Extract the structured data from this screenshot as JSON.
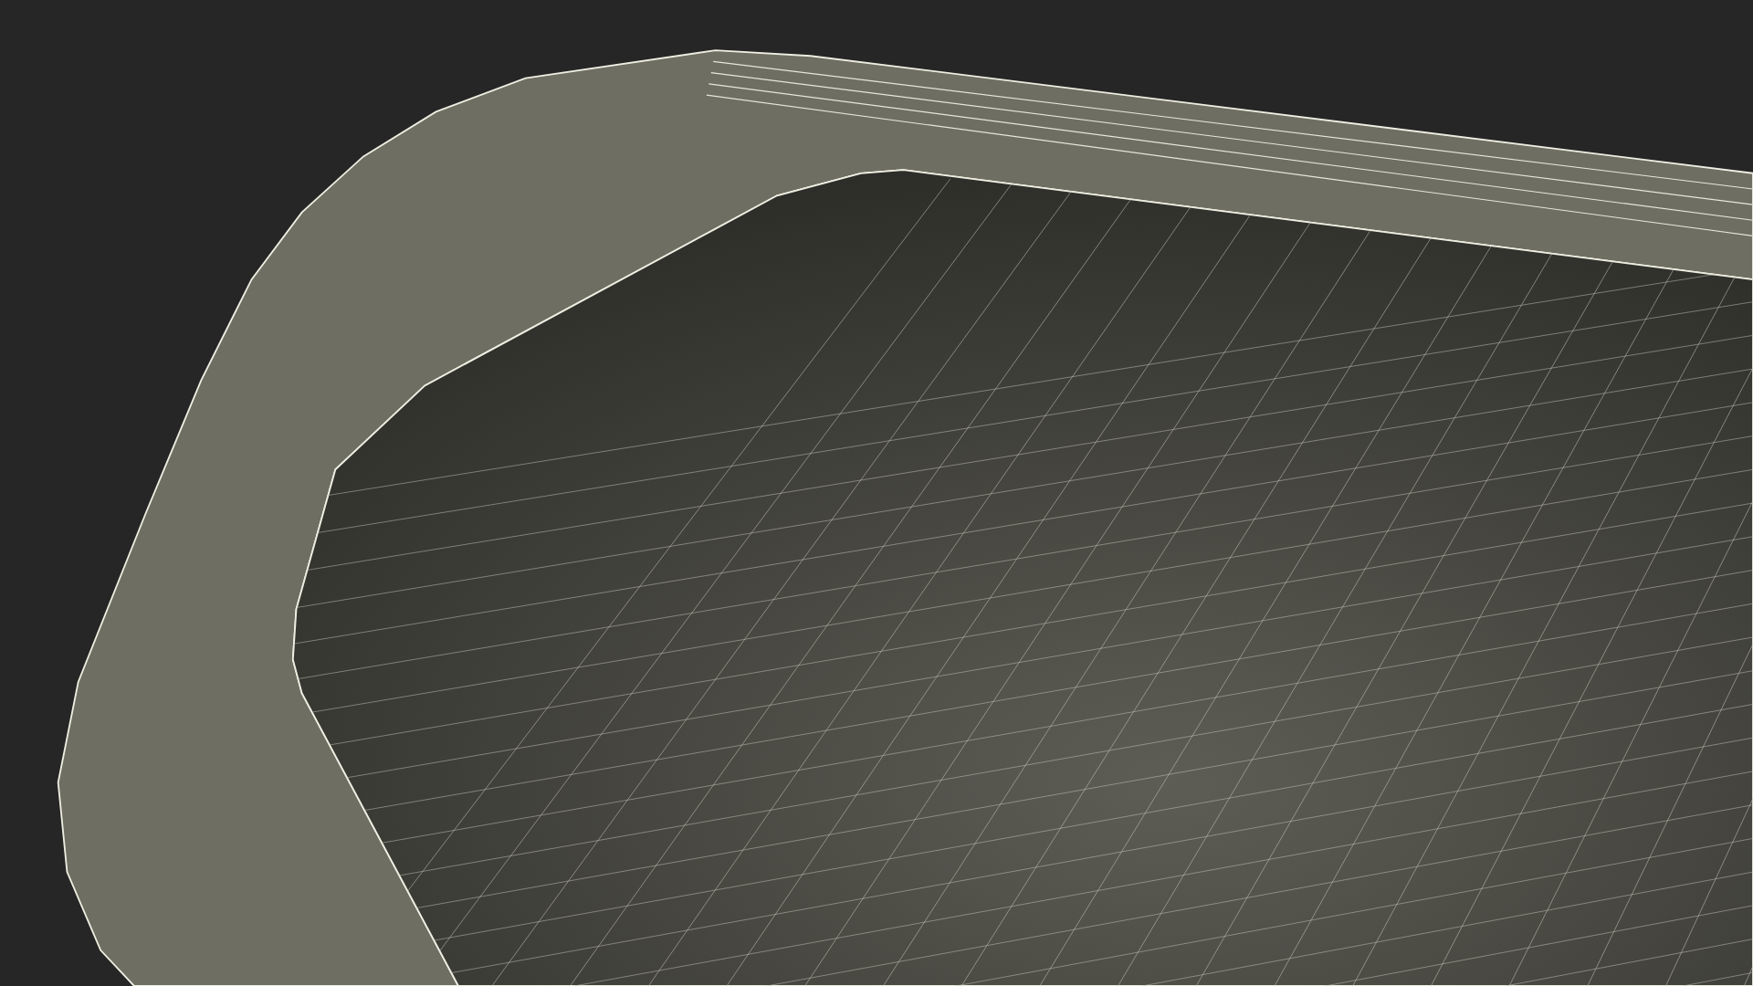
{
  "scene": {
    "kind": "wireframe-tray"
  }
}
